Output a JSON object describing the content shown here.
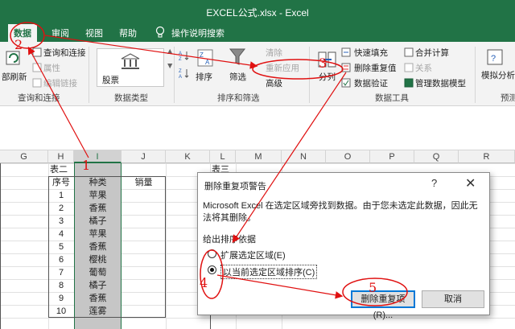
{
  "window": {
    "title": "EXCEL公式.xlsx - Excel"
  },
  "tabs": [
    {
      "label": "数据",
      "active": true
    },
    {
      "label": "审阅",
      "active": false
    },
    {
      "label": "视图",
      "active": false
    },
    {
      "label": "帮助",
      "active": false
    },
    {
      "label": "操作说明搜索",
      "active": false
    }
  ],
  "ribbon": {
    "refresh_label": "部刷新",
    "query_conn": "查询和连接",
    "properties": "属性",
    "edit_links": "编辑链接",
    "group_query": "查询和连接",
    "stock": "股票",
    "group_datatypes": "数据类型",
    "sort": "排序",
    "filter": "筛选",
    "clear": "清除",
    "reapply": "重新应用",
    "advanced": "高级",
    "group_sortfilter": "排序和筛选",
    "split": "分列",
    "flash_fill": "快速填充",
    "remove_dup": "删除重复值",
    "validation": "数据验证",
    "consolidate": "合并计算",
    "relations": "关系",
    "data_model": "管理数据模型",
    "group_tools": "数据工具",
    "whatif": "模拟分析",
    "forecast_sheet": "预测",
    "group_forecast": "预测"
  },
  "sheet": {
    "columns": [
      "G",
      "H",
      "I",
      "J",
      "K",
      "L",
      "M",
      "N",
      "O",
      "P",
      "Q",
      "R"
    ],
    "table2_title": "表二",
    "table3_title": "表三",
    "headers": [
      "序号",
      "种类",
      "销量"
    ],
    "rows": [
      [
        "1",
        "苹果"
      ],
      [
        "2",
        "香蕉"
      ],
      [
        "3",
        "橘子"
      ],
      [
        "4",
        "苹果"
      ],
      [
        "5",
        "香蕉"
      ],
      [
        "6",
        "樱桃"
      ],
      [
        "7",
        "葡萄"
      ],
      [
        "8",
        "橘子"
      ],
      [
        "9",
        "香蕉"
      ],
      [
        "10",
        "莲雾"
      ]
    ]
  },
  "dialog": {
    "title": "删除重复项警告",
    "help": "?",
    "message": "Microsoft Excel 在选定区域旁找到数据。由于您未选定此数据，因此无法将其删除。",
    "section": "给出排序依据",
    "option_expand": "扩展选定区域(E)",
    "option_current": "以当前选定区域排序(C)",
    "selected_option": "current",
    "btn_remove": "删除重复项(R)...",
    "btn_cancel": "取消"
  },
  "annotations": {
    "n1": "1",
    "n2": "2",
    "n3": "3",
    "n4": "4",
    "n5": "5",
    "color": "#e01010"
  }
}
